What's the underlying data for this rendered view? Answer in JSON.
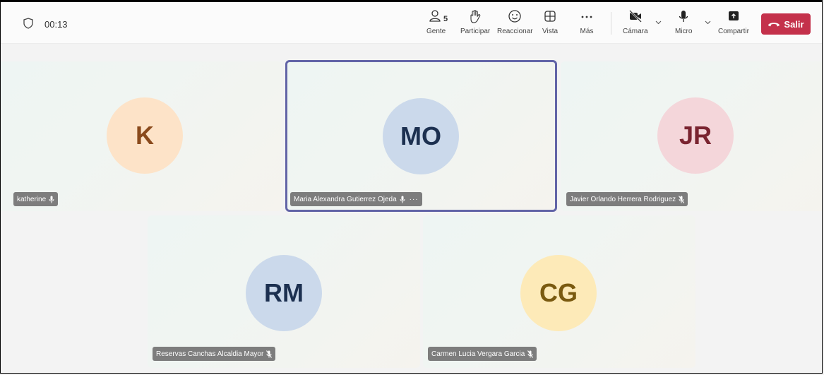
{
  "call": {
    "timer": "00:13"
  },
  "toolbar": {
    "people_count": "5",
    "people_label": "Gente",
    "raise_label": "Participar",
    "react_label": "Reaccionar",
    "view_label": "Vista",
    "more_label": "Más",
    "camera_label": "Cámara",
    "mic_label": "Micro",
    "share_label": "Compartir",
    "leave_label": "Salir"
  },
  "participants": [
    {
      "initials": "K",
      "name": "katherine",
      "avatar_bg": "#fde3c8",
      "avatar_fg": "#8a4a1c",
      "mic": "on"
    },
    {
      "initials": "MO",
      "name": "Maria Alexandra Gutierrez Ojeda",
      "avatar_bg": "#cbd9eb",
      "avatar_fg": "#1c3050",
      "mic": "on"
    },
    {
      "initials": "JR",
      "name": "Javier Orlando Herrera Rodriguez",
      "avatar_bg": "#f4d6da",
      "avatar_fg": "#7a2430",
      "mic": "muted"
    },
    {
      "initials": "RM",
      "name": "Reservas Canchas Alcaldia Mayor",
      "avatar_bg": "#cbd9eb",
      "avatar_fg": "#1c3050",
      "mic": "muted"
    },
    {
      "initials": "CG",
      "name": "Carmen Lucia Vergara Garcia",
      "avatar_bg": "#fdeab8",
      "avatar_fg": "#7a5a10",
      "mic": "muted"
    }
  ],
  "colors": {
    "accent": "#6264a7",
    "leave": "#c4314b"
  }
}
